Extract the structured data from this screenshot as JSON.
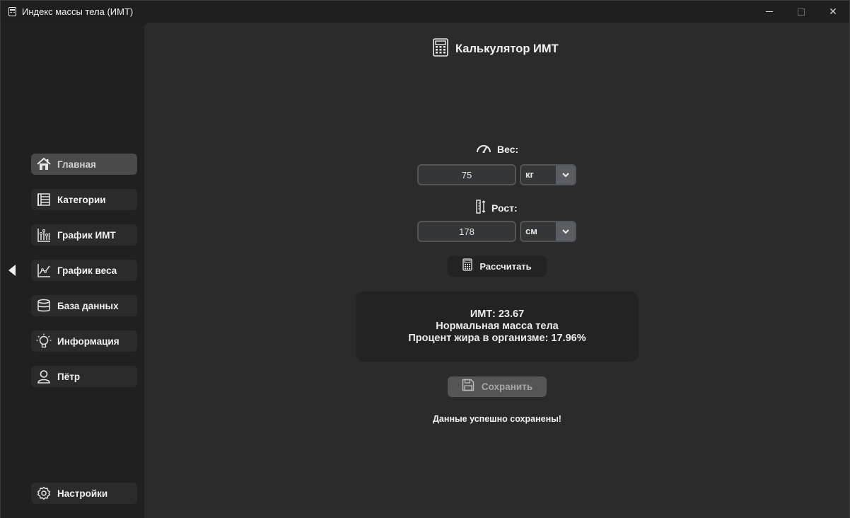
{
  "window": {
    "title": "Индекс массы тела (ИМТ)",
    "icon": "notepad-icon",
    "controls": {
      "minimize": "minimize-icon",
      "maximize": "maximize-icon",
      "close": "✕"
    }
  },
  "sidebar": {
    "items": [
      {
        "label": "Главная",
        "icon": "home-icon",
        "active": true
      },
      {
        "label": "Категории",
        "icon": "categories-icon",
        "active": false
      },
      {
        "label": "График ИМТ",
        "icon": "bar-chart-icon",
        "active": false
      },
      {
        "label": "График веса",
        "icon": "line-chart-icon",
        "active": false
      },
      {
        "label": "База данных",
        "icon": "database-icon",
        "active": false
      },
      {
        "label": "Информация",
        "icon": "lightbulb-icon",
        "active": false
      },
      {
        "label": "Пётр",
        "icon": "user-icon",
        "active": false
      }
    ],
    "settings": {
      "label": "Настройки",
      "icon": "gear-icon"
    }
  },
  "main": {
    "title": "Калькулятор ИМТ",
    "weight": {
      "label": "Вес:",
      "value": "75",
      "unit": "кг"
    },
    "height": {
      "label": "Рост:",
      "value": "178",
      "unit": "см"
    },
    "calculate_label": "Рассчитать",
    "result": {
      "bmi": "ИМТ: 23.67",
      "category": "Нормальная масса тела",
      "fat": "Процент жира в организме: 17.96%"
    },
    "save_label": "Сохранить",
    "status": "Данные успешно сохранены!"
  },
  "colors": {
    "background": "#2b2b2b",
    "sidebar": "#202020",
    "active_item": "#4a4a4a",
    "text": "#f0f0f0"
  }
}
